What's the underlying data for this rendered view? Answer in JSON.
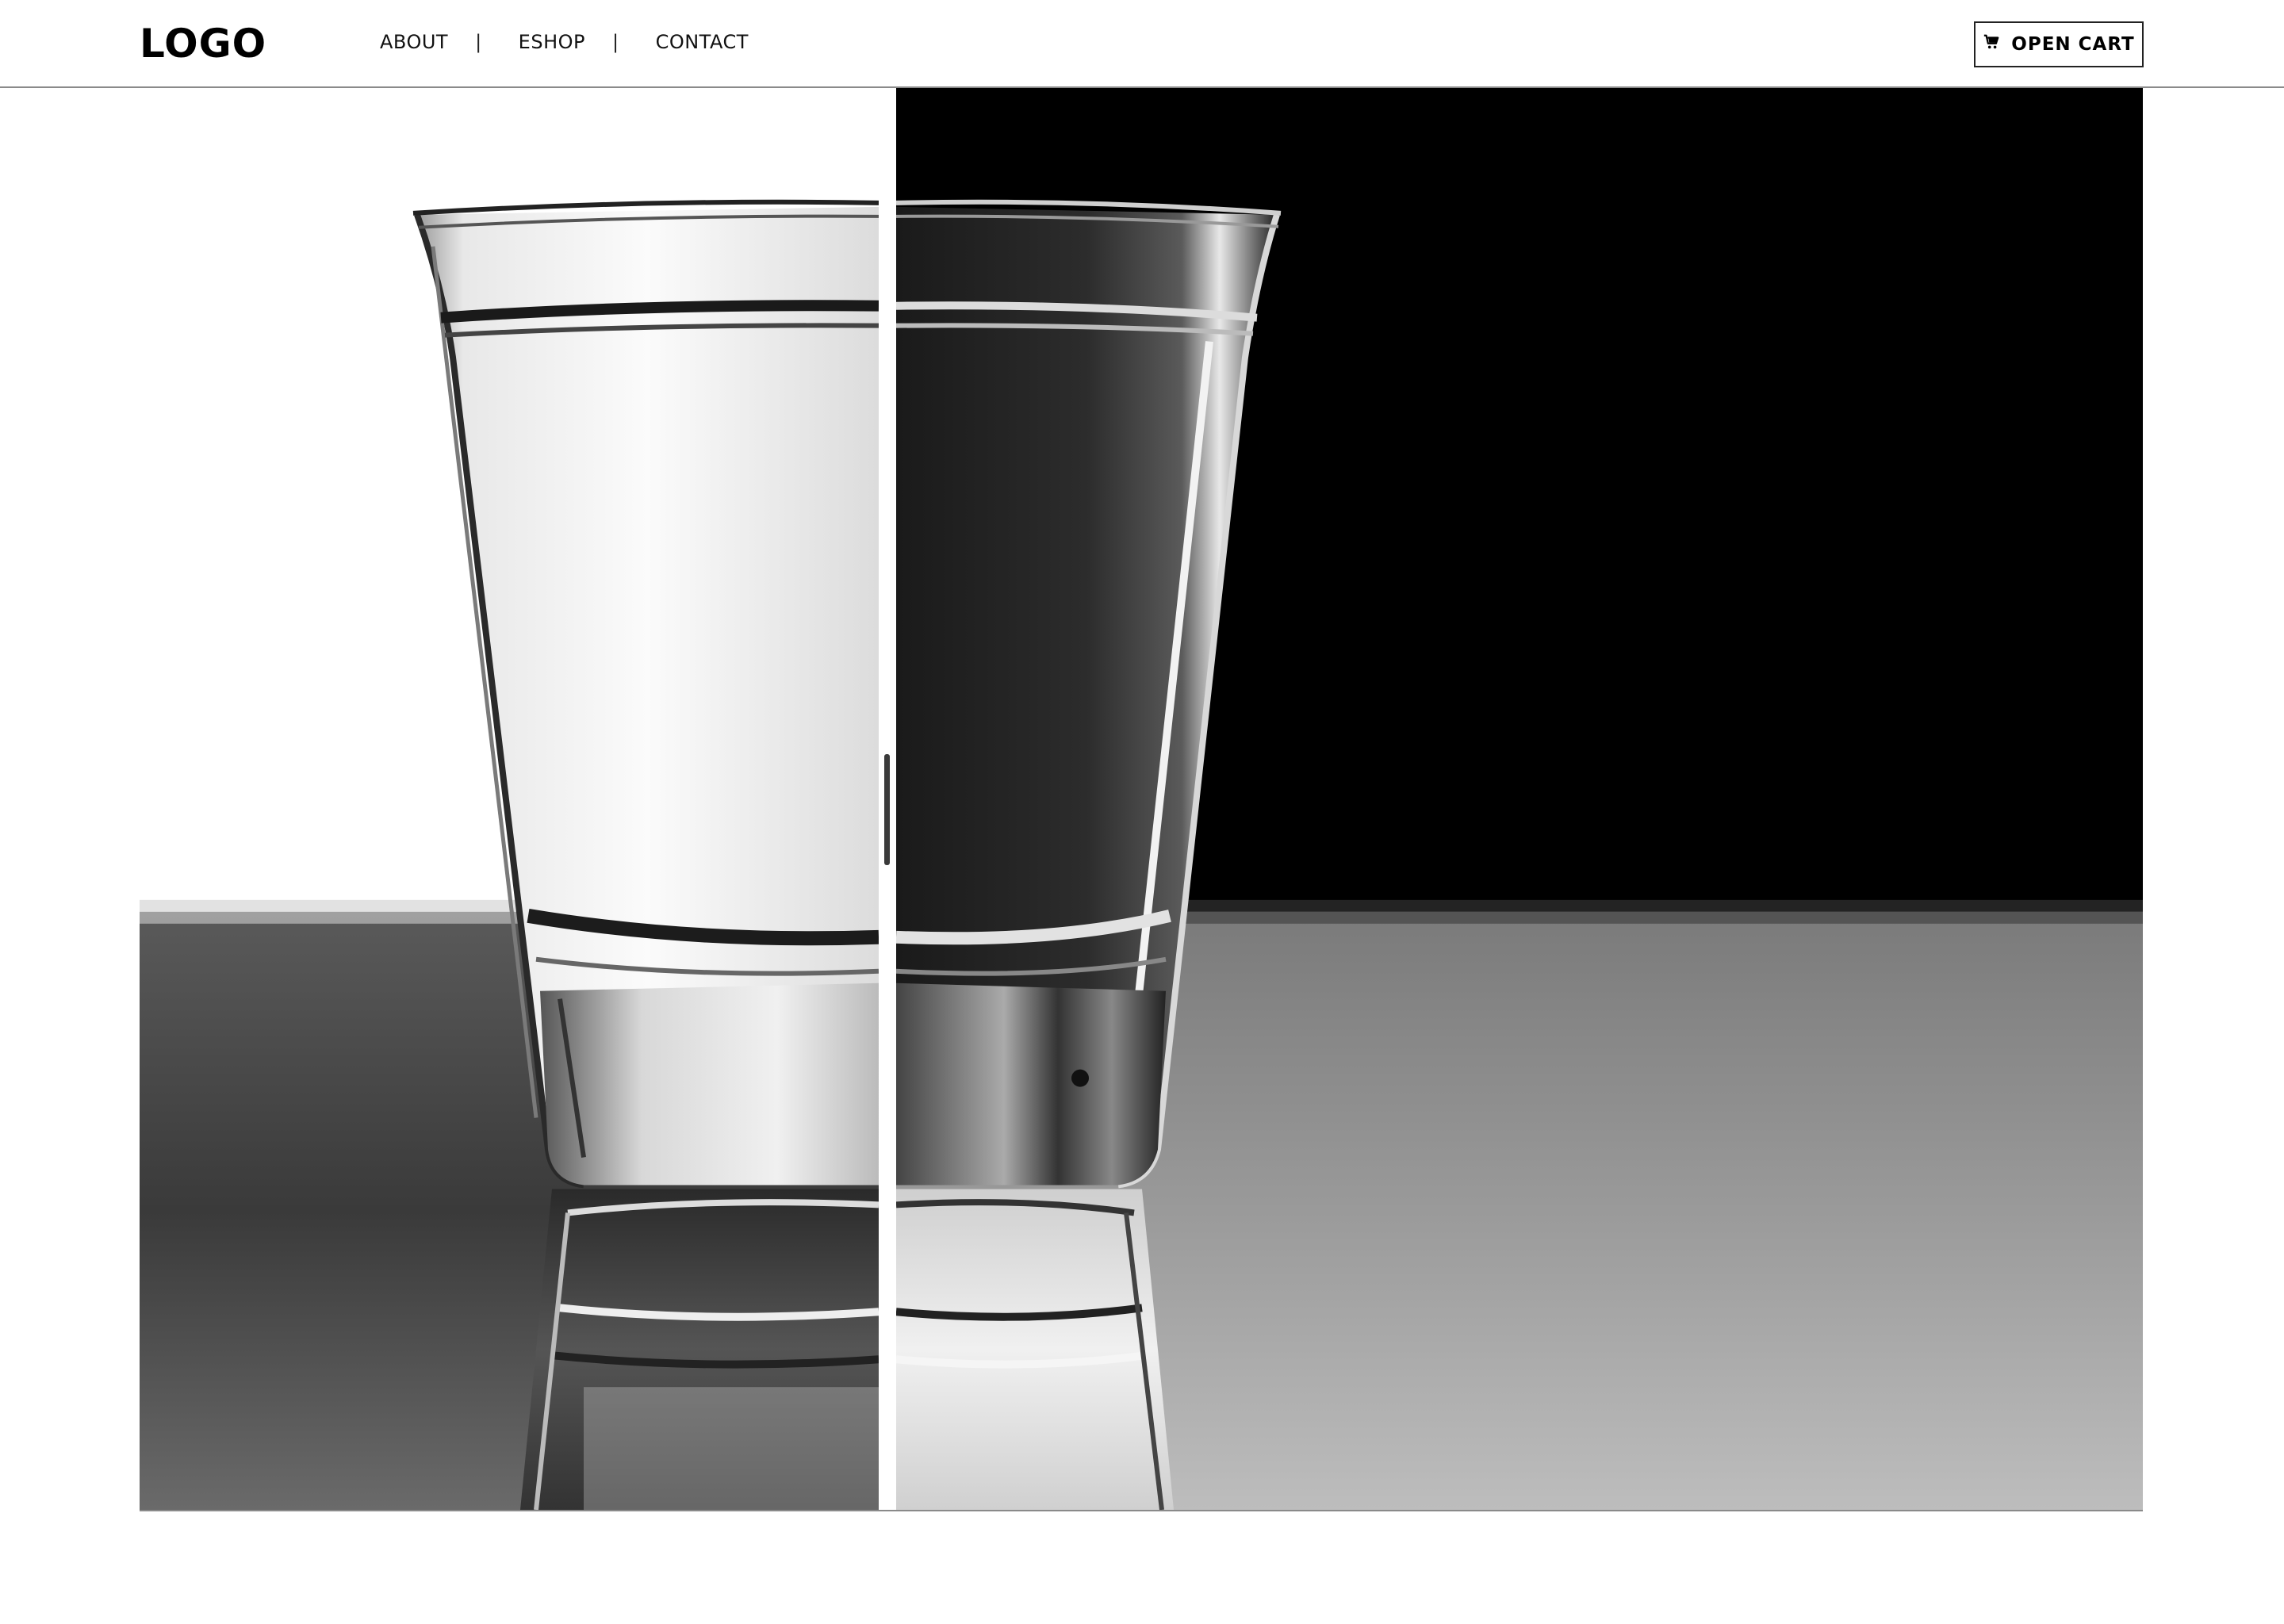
{
  "header": {
    "logo": "LOGO",
    "nav": [
      {
        "label": "ABOUT"
      },
      {
        "label": "ESHOP"
      },
      {
        "label": "CONTACT"
      }
    ],
    "separator": "|",
    "cart_button": {
      "label": "OPEN CART",
      "icon": "cart-icon"
    }
  },
  "hero": {
    "left_image": "shot glass on white background",
    "right_image": "shot glass on black background",
    "divider": "comparison-slider-handle"
  }
}
